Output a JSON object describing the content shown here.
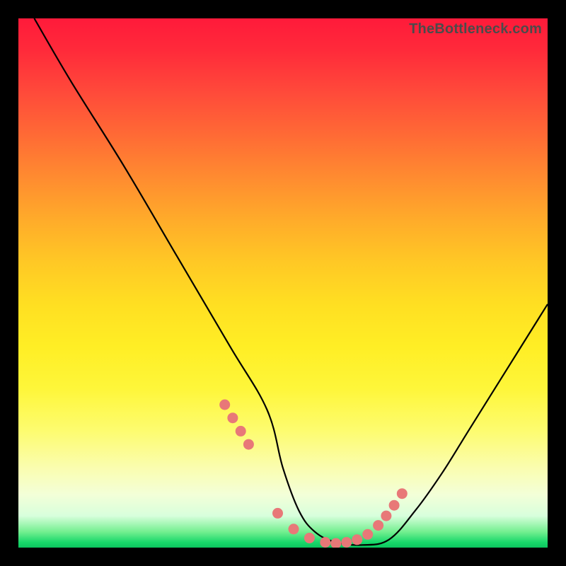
{
  "watermark": "TheBottleneck.com",
  "chart_data": {
    "type": "line",
    "title": "",
    "xlabel": "",
    "ylabel": "",
    "xlim": [
      0,
      100
    ],
    "ylim": [
      0,
      100
    ],
    "x": [
      3,
      10,
      20,
      30,
      40,
      47,
      50,
      53,
      56,
      60,
      65,
      70,
      75,
      80,
      85,
      90,
      100
    ],
    "values": [
      100,
      88,
      72,
      55,
      38,
      26,
      15,
      7,
      3,
      1,
      0.5,
      1.5,
      7,
      14,
      22,
      30,
      46
    ],
    "marker_points_x": [
      39,
      40.5,
      42,
      43.5,
      49,
      52,
      55,
      58,
      60,
      62,
      64,
      66,
      68,
      69.5,
      71,
      72.5
    ],
    "marker_points_y": [
      27,
      24.5,
      22,
      19.5,
      6.5,
      3.5,
      1.8,
      1.0,
      0.8,
      1.0,
      1.5,
      2.5,
      4.2,
      6.0,
      8.0,
      10.2
    ],
    "marker_color": "#e87878",
    "curve_color": "#000000",
    "gradient_stops": [
      {
        "pos": 0.0,
        "color": "#ff1a3a"
      },
      {
        "pos": 0.5,
        "color": "#ffd628"
      },
      {
        "pos": 0.85,
        "color": "#fafdb0"
      },
      {
        "pos": 1.0,
        "color": "#0cc45e"
      }
    ]
  }
}
